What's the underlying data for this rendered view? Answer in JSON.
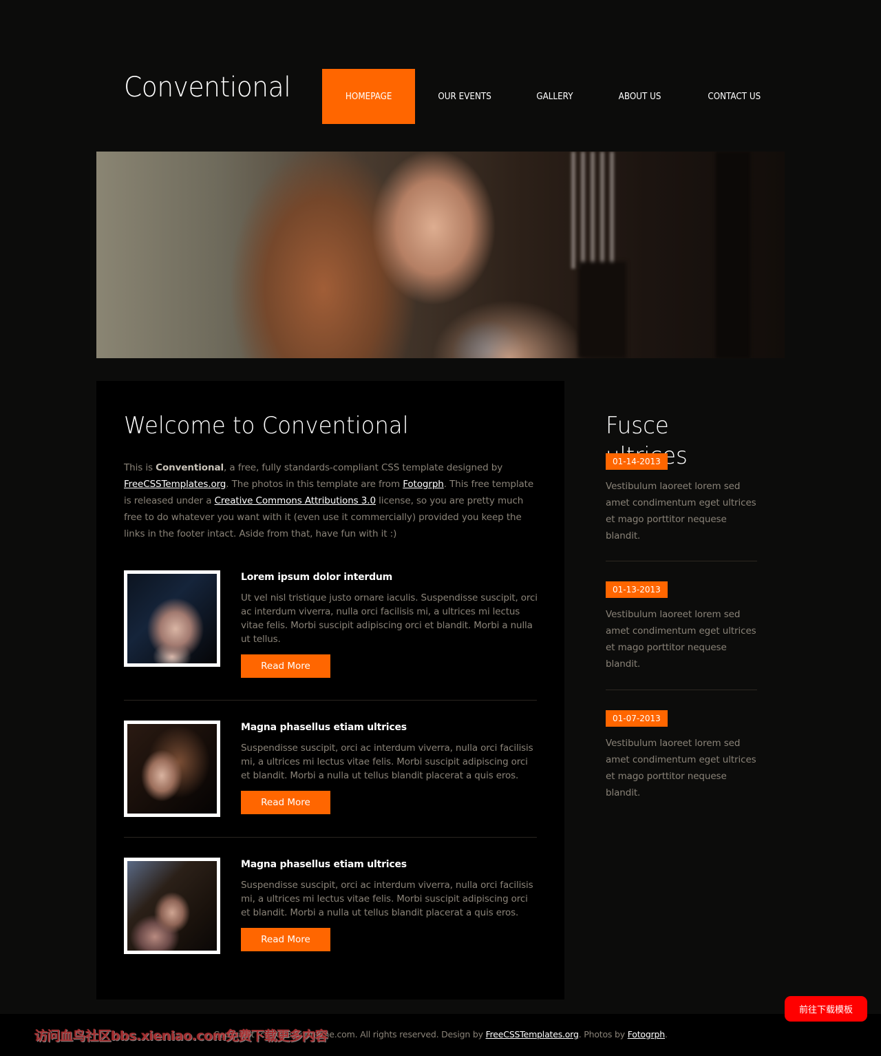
{
  "site": {
    "logo": "Conventional"
  },
  "menu": {
    "items": [
      {
        "label": "HOMEPAGE",
        "active": true
      },
      {
        "label": "OUR EVENTS",
        "active": false
      },
      {
        "label": "GALLERY",
        "active": false
      },
      {
        "label": "ABOUT US",
        "active": false
      },
      {
        "label": "CONTACT US",
        "active": false
      }
    ]
  },
  "banner": {
    "image": "woman-portrait-photo"
  },
  "content": {
    "title": "Welcome to Conventional",
    "intro": {
      "part1": "This is ",
      "bold": "Conventional",
      "part2": ", a free, fully standards-compliant CSS template designed by ",
      "link1": "FreeCSSTemplates.org",
      "part3": ". The photos in this template are from ",
      "link2": "Fotogrph",
      "part4": ". This free template is released under a ",
      "link3": "Creative Commons Attributions 3.0",
      "part5": " license, so you are pretty much free to do whatever you want with it (even use it commercially) provided you keep the links in the footer intact. Aside from that, have fun with it :)"
    },
    "posts": [
      {
        "title": "Lorem ipsum dolor interdum",
        "text": "Ut vel nisl tristique justo ornare iaculis. Suspendisse suscipit, orci ac interdum viverra, nulla orci facilisis mi, a ultrices mi lectus vitae felis. Morbi suscipit adipiscing orci et blandit. Morbi a nulla ut tellus.",
        "button": "Read More",
        "image": "woman-dark-hair-photo"
      },
      {
        "title": "Magna phasellus etiam ultrices",
        "text": "Suspendisse suscipit, orci ac interdum viverra, nulla orci facilisis mi, a ultrices mi lectus vitae felis. Morbi suscipit adipiscing orci et blandit. Morbi a nulla ut tellus blandit placerat a quis eros.",
        "button": "Read More",
        "image": "woman-brown-hair-photo"
      },
      {
        "title": "Magna phasellus etiam ultrices",
        "text": "Suspendisse suscipit, orci ac interdum viverra, nulla orci facilisis mi, a ultrices mi lectus vitae felis. Morbi suscipit adipiscing orci et blandit. Morbi a nulla ut tellus blandit placerat a quis eros.",
        "button": "Read More",
        "image": "woman-scarf-photo"
      }
    ]
  },
  "sidebar": {
    "title": "Fusce ultrices",
    "news": [
      {
        "date": "01-14-2013",
        "text": "Vestibulum laoreet lorem sed amet condimentum eget ultrices et mago porttitor nequese blandit."
      },
      {
        "date": "01-13-2013",
        "text": "Vestibulum laoreet lorem sed amet condimentum eget ultrices et mago porttitor nequese blandit."
      },
      {
        "date": "01-07-2013",
        "text": "Vestibulum laoreet lorem sed amet condimentum eget ultrices et mago porttitor nequese blandit."
      }
    ]
  },
  "footer": {
    "copyright_prefix": "Copyright (c) 2013 Sitename.com. All rights reserved. Design by ",
    "link1": "FreeCSSTemplates.org",
    "middle": ". Photos by ",
    "link2": "Fotogrph",
    "suffix": "."
  },
  "overlay": {
    "download_button": "前往下载模板",
    "watermark": "访问血鸟社区bbs.xieniao.com免费下载更多内容"
  },
  "colors": {
    "accent": "#ff6600",
    "background": "#0c0c0b",
    "content_bg": "#000000",
    "download_button": "#ff0000"
  }
}
